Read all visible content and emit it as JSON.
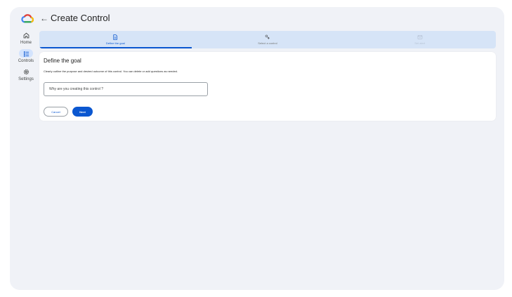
{
  "header": {
    "title": "Create Control",
    "back_icon": "arrow-back-icon",
    "logo_icon": "cloud-logo-icon"
  },
  "nav": {
    "items": [
      {
        "label": "Home",
        "icon": "home-icon",
        "active": false
      },
      {
        "label": "Controls",
        "icon": "controls-icon",
        "active": true
      },
      {
        "label": "Settings",
        "icon": "gear-icon",
        "active": false
      }
    ]
  },
  "stepper": {
    "steps": [
      {
        "label": "Define the goal",
        "icon": "document-icon",
        "state": "active"
      },
      {
        "label": "Select a control",
        "icon": "select-control-icon",
        "state": "pending"
      },
      {
        "label": "Set alert",
        "icon": "alert-icon",
        "state": "disabled"
      }
    ]
  },
  "goal_card": {
    "title": "Define the goal",
    "description": "Clearly outline the purpose and desired outcome of this control. You can delete or add questions as needed.",
    "input_value": "",
    "input_placeholder": "Why are you creating this control ?",
    "cancel_label": "Cancel",
    "next_label": "Next"
  },
  "colors": {
    "accent": "#0b57d0",
    "background": "#f0f2f7",
    "stepper_bg": "#d6e4f7",
    "nav_active": "#d3e3fd"
  }
}
